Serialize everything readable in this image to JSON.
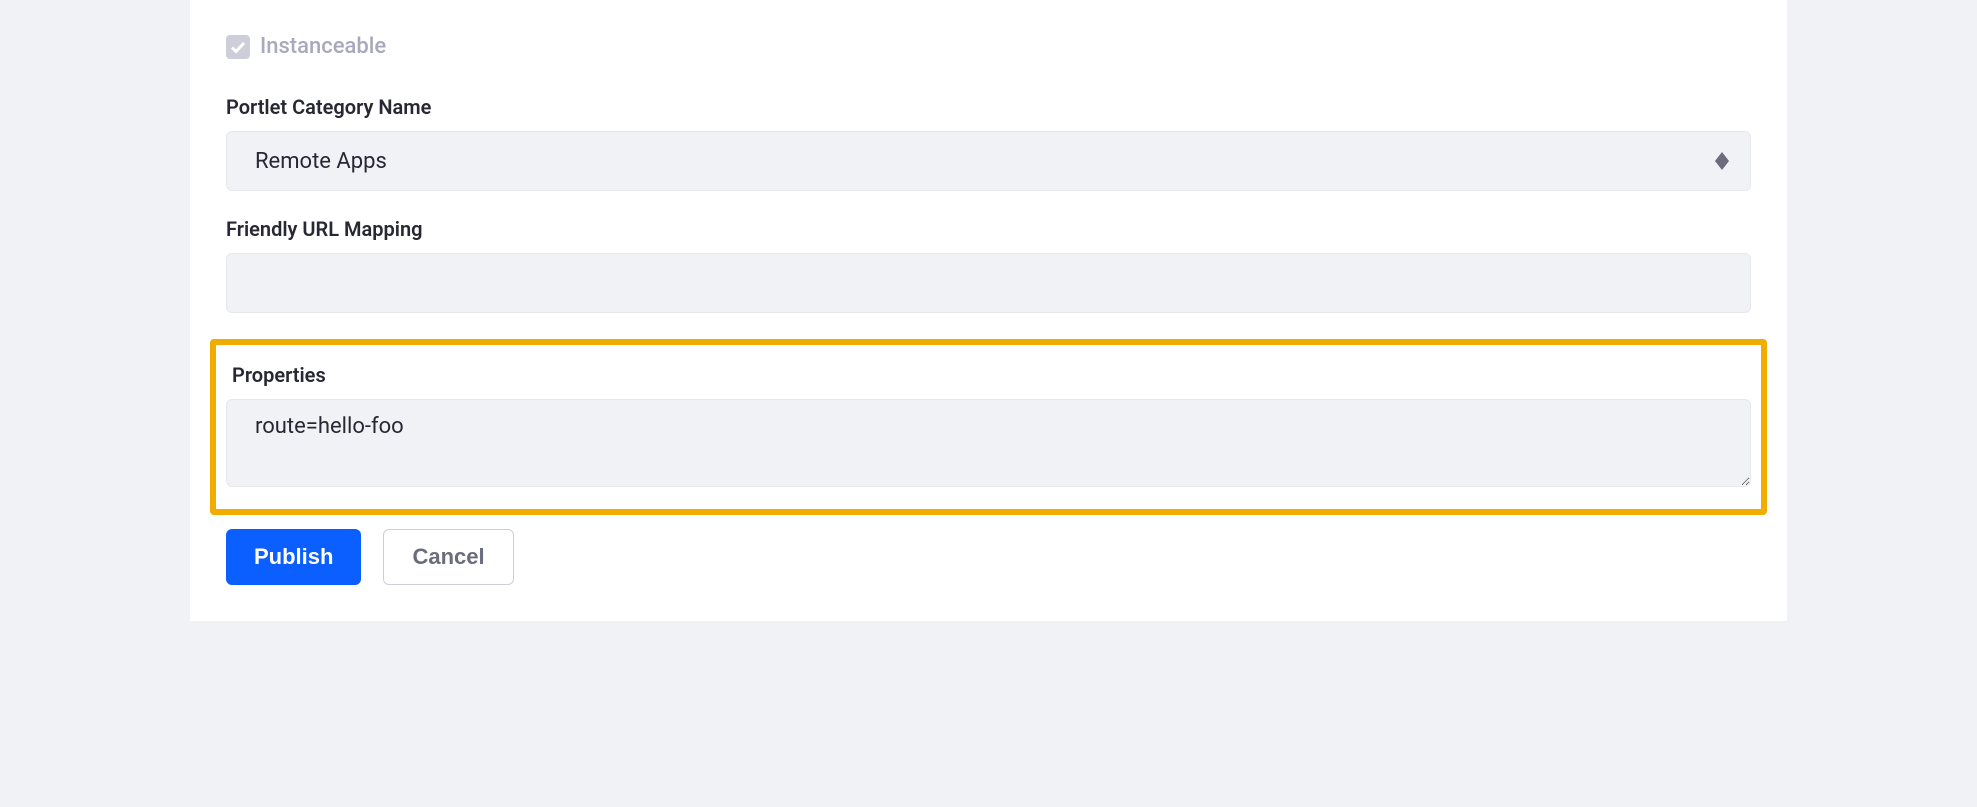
{
  "form": {
    "instanceable": {
      "label": "Instanceable",
      "checked": true
    },
    "portlet_category": {
      "label": "Portlet Category Name",
      "value": "Remote Apps"
    },
    "friendly_url": {
      "label": "Friendly URL Mapping",
      "value": ""
    },
    "properties": {
      "label": "Properties",
      "value": "route=hello-foo"
    },
    "buttons": {
      "publish": "Publish",
      "cancel": "Cancel"
    }
  }
}
